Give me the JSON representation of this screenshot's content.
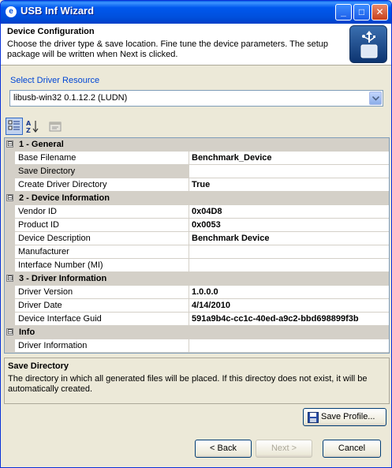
{
  "window": {
    "title": "USB Inf Wizard",
    "minimize": "_",
    "maximize": "□",
    "close": "✕",
    "app_icon": "e"
  },
  "header": {
    "title": "Device Configuration",
    "description": "Choose the driver type & save location. Fine tune the device parameters.  The setup package will be written when Next is clicked.",
    "logo_icon": "usb-icon"
  },
  "driver_resource": {
    "label": "Select Driver Resource",
    "selected": "libusb-win32 0.1.12.2 (LUDN)"
  },
  "toolbar": {
    "categorized_icon": "categorized-icon",
    "alphabetical_icon": "sort-alphabetical-icon",
    "property_pages_icon": "property-pages-icon"
  },
  "property_grid": {
    "categories": [
      {
        "label": "1 - General",
        "expander": "⊟",
        "properties": [
          {
            "name": "Base Filename",
            "value": "Benchmark_Device"
          },
          {
            "name": "Save Directory",
            "value": ""
          },
          {
            "name": "Create Driver Directory",
            "value": "True"
          }
        ]
      },
      {
        "label": "2 - Device Information",
        "expander": "⊟",
        "properties": [
          {
            "name": "Vendor ID",
            "value": "0x04D8"
          },
          {
            "name": "Product ID",
            "value": "0x0053"
          },
          {
            "name": "Device Description",
            "value": "Benchmark Device"
          },
          {
            "name": "Manufacturer",
            "value": ""
          },
          {
            "name": "Interface Number (MI)",
            "value": ""
          }
        ]
      },
      {
        "label": "3 - Driver Information",
        "expander": "⊟",
        "properties": [
          {
            "name": "Driver Version",
            "value": "1.0.0.0"
          },
          {
            "name": "Driver Date",
            "value": "4/14/2010"
          },
          {
            "name": "Device Interface Guid",
            "value": "591a9b4c-cc1c-40ed-a9c2-bbd698899f3b"
          }
        ]
      },
      {
        "label": "Info",
        "expander": "⊟",
        "properties": [
          {
            "name": "Driver Information",
            "value": ""
          }
        ]
      }
    ]
  },
  "help_panel": {
    "title": "Save Directory",
    "text": "The directory in which all generated files will be placed.  If this directoy does not exist, it will be automatically created."
  },
  "buttons": {
    "save_profile": "Save Profile...",
    "back": "< Back",
    "next": "Next >",
    "cancel": "Cancel"
  },
  "colors": {
    "title_bar": "#0054e3",
    "group_label": "#0046d5",
    "panel_background": "#ece9d8",
    "grid_line": "#d4d0c8"
  }
}
